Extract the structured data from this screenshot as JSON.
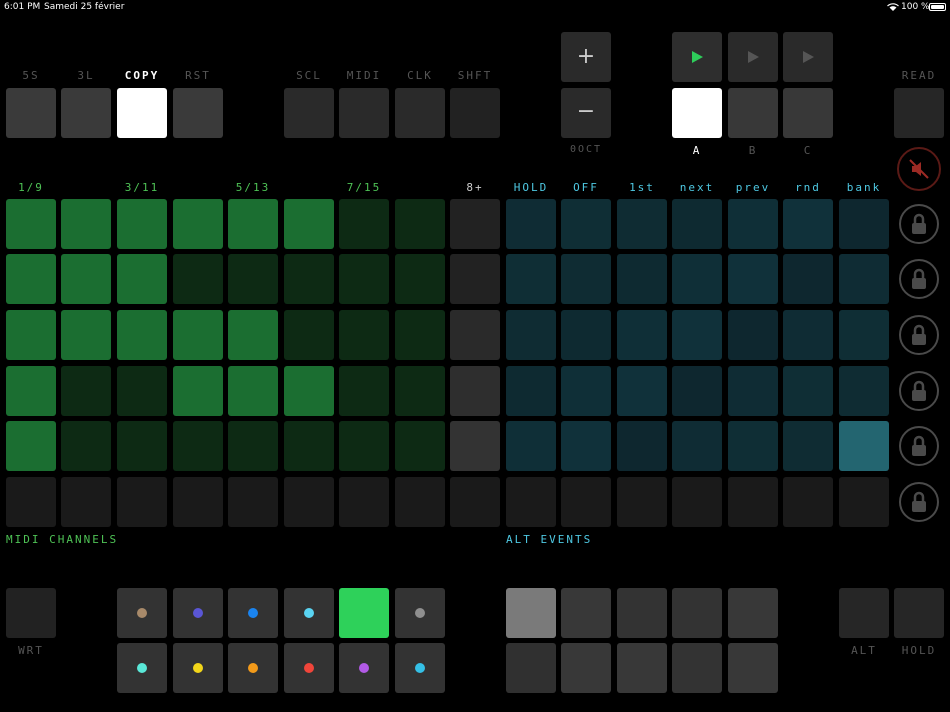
{
  "status_bar": {
    "time": "6:01 PM",
    "date": "Samedi 25 février",
    "battery": "100 %"
  },
  "top_labels": {
    "btn_5s": "5S",
    "btn_3l": "3L",
    "btn_copy": "COPY",
    "btn_rst": "RST",
    "btn_scl": "SCL",
    "btn_midi": "MIDI",
    "btn_clk": "CLK",
    "btn_shft": "SHFT",
    "plus": "+",
    "minus": "−",
    "oct": "0OCT",
    "pattern_a": "A",
    "pattern_b": "B",
    "pattern_c": "C",
    "read": "READ"
  },
  "grid_headers": {
    "g1": "1/9",
    "g2": "3/11",
    "g3": "5/13",
    "g4": "7/15",
    "g5": "8+",
    "hold": "HOLD",
    "off": "OFF",
    "first": "1st",
    "next": "next",
    "prev": "prev",
    "rnd": "rnd",
    "bank": "bank"
  },
  "section_labels": {
    "midi_channels": "MIDI CHANNELS",
    "alt_events": "ALT EVENTS"
  },
  "bottom_labels": {
    "wrt": "WRT",
    "alt": "ALT",
    "hold": "HOLD"
  },
  "colors": {
    "green_on": "#1b6e31",
    "green_off": "#0d2a14",
    "teal": "#0f2f37",
    "teal_dark": "#0d252c",
    "teal_active": "#236570",
    "play_green": "#2ecc5a",
    "mute_red": "#9c2a24"
  },
  "icons": {
    "play": "play-icon",
    "mute": "speaker-muted-icon",
    "lock": "lock-icon"
  },
  "midi_dot_colors": [
    [
      "#a88a6a",
      "#5a56d6",
      "#1a84f0",
      "#5ad4f2",
      null,
      "#8f8f8f"
    ],
    [
      "#5ae8d8",
      "#f2d61a",
      "#f29a1a",
      "#f0453a",
      "#b25ae6",
      "#35c0e6"
    ]
  ],
  "green_grid": [
    [
      1,
      1,
      1,
      1,
      1,
      1,
      0,
      0
    ],
    [
      1,
      1,
      1,
      0,
      0,
      0,
      0,
      0
    ],
    [
      1,
      1,
      1,
      1,
      1,
      0,
      0,
      0
    ],
    [
      1,
      0,
      0,
      1,
      1,
      1,
      0,
      0
    ],
    [
      1,
      0,
      0,
      0,
      0,
      0,
      0,
      0
    ]
  ],
  "teal_active_cell": {
    "row": 5,
    "col": 6
  }
}
